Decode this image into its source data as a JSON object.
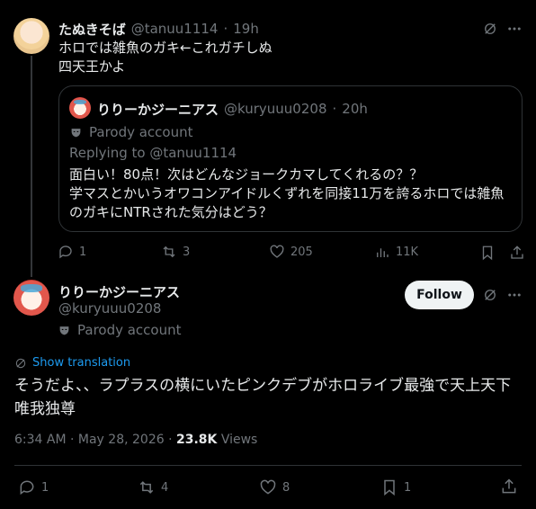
{
  "parent": {
    "display_name": "たぬきそば",
    "handle": "@tanuu1114",
    "time": "19h",
    "text_line1": "ホロでは雑魚のガキ←これガチしぬ",
    "text_line2": "四天王かよ",
    "quote": {
      "display_name": "りりーかジーニアス",
      "handle": "@kuryuuu0208",
      "time": "20h",
      "parody_label": "Parody account",
      "replying_to": "Replying to @tanuu1114",
      "text_line1": "面白い！80点！次はどんなジョークカマしてくれるの？？",
      "text_line2": "学マスとかいうオワコンアイドルくずれを同接11万を誇るホロでは雑魚",
      "text_line3": "のガキにNTRされた気分はどう？"
    },
    "actions": {
      "replies": "1",
      "reposts": "3",
      "likes": "205",
      "views": "11K"
    }
  },
  "main": {
    "display_name": "りりーかジーニアス",
    "handle": "@kuryuuu0208",
    "parody_label": "Parody account",
    "follow_label": "Follow",
    "translate_label": "Show translation",
    "text_line1": "そうだよ、、ラプラスの横にいたピンクデブがホロライブ最強で天上天下",
    "text_line2": "唯我独尊",
    "timestamp": "6:34 AM · May 28, 2026 · ",
    "views_count": "23.8K",
    "views_label": " Views",
    "actions": {
      "replies": "1",
      "reposts": "4",
      "likes": "8",
      "bookmarks": "1"
    }
  },
  "icons": [
    "grok-icon",
    "more-icon",
    "reply-icon",
    "repost-icon",
    "like-icon",
    "views-icon",
    "bookmark-icon",
    "share-icon",
    "translate-icon",
    "parody-mask-icon"
  ],
  "colors": {
    "background": "#000000",
    "text": "#e7e9ea",
    "muted": "#71767b",
    "link": "#1d9bf0",
    "border": "#2f3336"
  }
}
